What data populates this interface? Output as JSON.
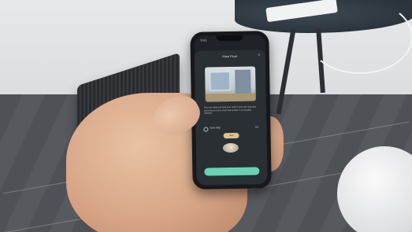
{
  "phone": {
    "status_time": "9:41",
    "sheet_title": "Main Floor",
    "close_glyph": "×",
    "description": "The new robot can map your entire home with accuracy and ensures every room and surface is thoroughly cleaned.",
    "option_label": "Save Map",
    "option_value": "Yes",
    "pill_label": "Set"
  },
  "icons": {
    "close": "close-icon",
    "radio": "radio-icon"
  },
  "colors": {
    "accent": "#67d3b5",
    "sheet": "#2a2f33",
    "pill": "#d8c48a"
  }
}
